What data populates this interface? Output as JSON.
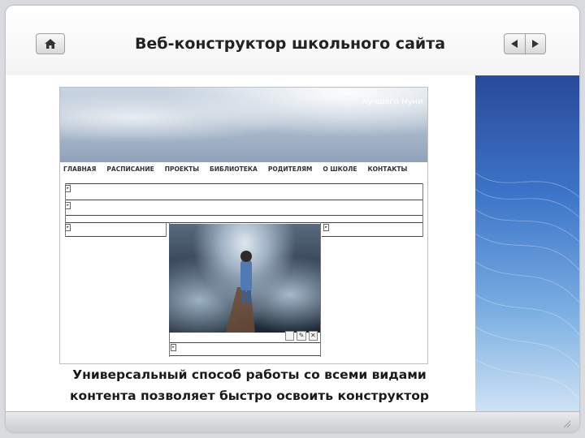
{
  "header": {
    "title": "Веб-конструктор школьного сайта",
    "home_icon": "home-icon",
    "prev_icon": "triangle-left-icon",
    "next_icon": "triangle-right-icon"
  },
  "screenshot": {
    "banner_text": "лучшего муни",
    "menu": [
      "ГЛАВНАЯ",
      "РАСПИСАНИЕ",
      "ПРОЕКТЫ",
      "БИБЛИОТЕКА",
      "РОДИТЕЛЯМ",
      "О ШКОЛЕ",
      "КОНТАКТЫ"
    ]
  },
  "caption": {
    "line1": "Универсальный способ работы со всеми видами",
    "line2": "контента позволяет быстро освоить конструктор"
  },
  "colors": {
    "accent_panel_top": "#2a4a9a",
    "accent_panel_bottom": "#cfe2f5",
    "title_text": "#222222"
  }
}
